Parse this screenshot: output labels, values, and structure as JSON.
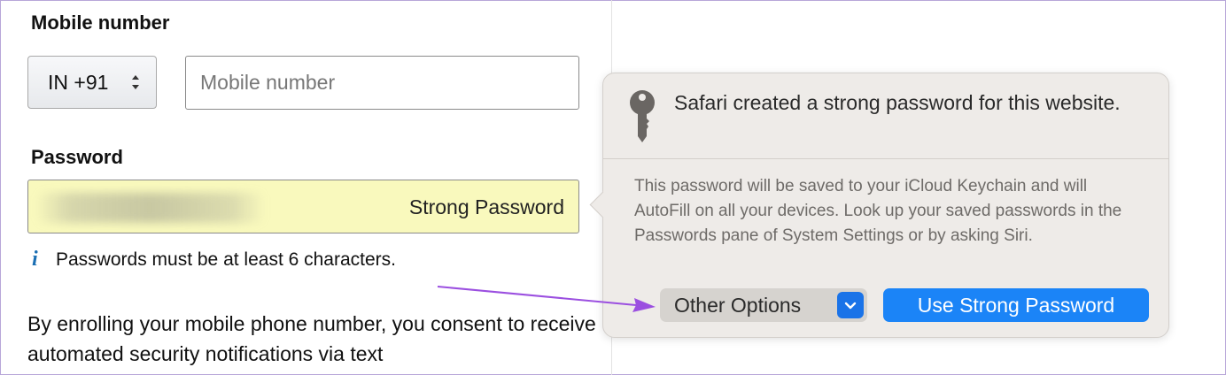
{
  "form": {
    "mobile_label": "Mobile number",
    "country_code": "IN +91",
    "mobile_placeholder": "Mobile number",
    "password_label": "Password",
    "password_strength": "Strong Password",
    "password_hint": "Passwords must be at least 6 characters.",
    "consent_text": "By enrolling your mobile phone number, you consent to receive automated security notifications via text"
  },
  "popover": {
    "title": "Safari created a strong password for this website.",
    "body": "This password will be saved to your iCloud Keychain and will AutoFill on all your devices. Look up your saved passwords in the Passwords pane of System Settings or by asking Siri.",
    "other_options_label": "Other Options",
    "use_strong_label": "Use Strong Password"
  },
  "icons": {
    "country_chevron": "up-down-chevron-icon",
    "info": "info-icon",
    "key": "key-icon",
    "dropdown": "chevron-down-icon",
    "annotation": "annotation-arrow"
  },
  "colors": {
    "autofill_yellow": "#f9f9bd",
    "accent_blue": "#1b84f7",
    "info_blue": "#1b6fb3",
    "arrow_purple": "#9b4fe0",
    "popover_bg": "#eeebe8"
  }
}
